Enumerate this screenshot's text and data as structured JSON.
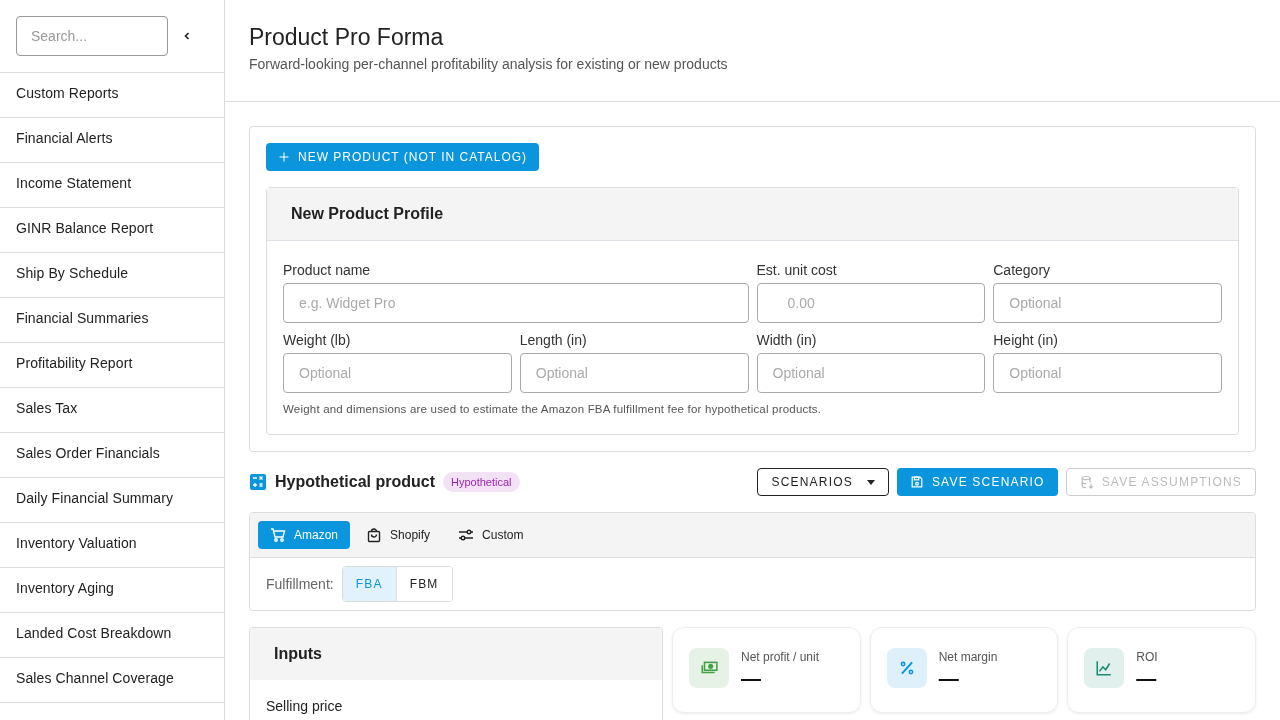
{
  "sidebar": {
    "search": {
      "placeholder": "Search..."
    },
    "items": [
      "Custom Reports",
      "Financial Alerts",
      "Income Statement",
      "GINR Balance Report",
      "Ship By Schedule",
      "Financial Summaries",
      "Profitability Report",
      "Sales Tax",
      "Sales Order Financials",
      "Daily Financial Summary",
      "Inventory Valuation",
      "Inventory Aging",
      "Landed Cost Breakdown",
      "Sales Channel Coverage"
    ]
  },
  "page": {
    "title": "Product Pro Forma",
    "subtitle": "Forward-looking per-channel profitability analysis for existing or new products"
  },
  "new_product_button": "NEW PRODUCT (NOT IN CATALOG)",
  "profile": {
    "title": "New Product Profile",
    "fields": [
      {
        "label": "Product name",
        "placeholder": "e.g. Widget Pro",
        "kind": "wide"
      },
      {
        "label": "Est. unit cost",
        "placeholder": "0.00",
        "kind": "money"
      },
      {
        "label": "Category",
        "placeholder": "Optional",
        "kind": "text"
      },
      {
        "label": "Weight (lb)",
        "placeholder": "Optional",
        "kind": "text"
      },
      {
        "label": "Length (in)",
        "placeholder": "Optional",
        "kind": "text"
      },
      {
        "label": "Width (in)",
        "placeholder": "Optional",
        "kind": "text"
      },
      {
        "label": "Height (in)",
        "placeholder": "Optional",
        "kind": "text"
      }
    ],
    "note": "Weight and dimensions are used to estimate the Amazon FBA fulfillment fee for hypothetical products."
  },
  "product_header": {
    "title": "Hypothetical product",
    "badge": "Hypothetical"
  },
  "actions": [
    {
      "kind": "dropdown",
      "label": "SCENARIOS",
      "disabled": false
    },
    {
      "kind": "save",
      "label": "SAVE SCENARIO",
      "disabled": false
    },
    {
      "kind": "database",
      "label": "SAVE ASSUMPTIONS",
      "disabled": true
    }
  ],
  "channels": [
    {
      "kind": "cart",
      "label": "Amazon",
      "selected": true
    },
    {
      "kind": "bag",
      "label": "Shopify",
      "selected": false
    },
    {
      "kind": "sliders",
      "label": "Custom",
      "selected": false
    }
  ],
  "fulfillment": {
    "label": "Fulfillment:",
    "options": [
      {
        "label": "FBA",
        "selected": true
      },
      {
        "label": "FBM",
        "selected": false
      }
    ]
  },
  "inputs": {
    "title": "Inputs",
    "fields": [
      "Selling price"
    ]
  },
  "metrics": [
    {
      "kind": "cash",
      "label": "Net profit / unit",
      "value": "—",
      "color": "#43a047"
    },
    {
      "kind": "percent",
      "label": "Net margin",
      "value": "—",
      "color": "#0a95dc"
    },
    {
      "kind": "chart",
      "label": "ROI",
      "value": "—",
      "color": "#1b8a77"
    }
  ]
}
